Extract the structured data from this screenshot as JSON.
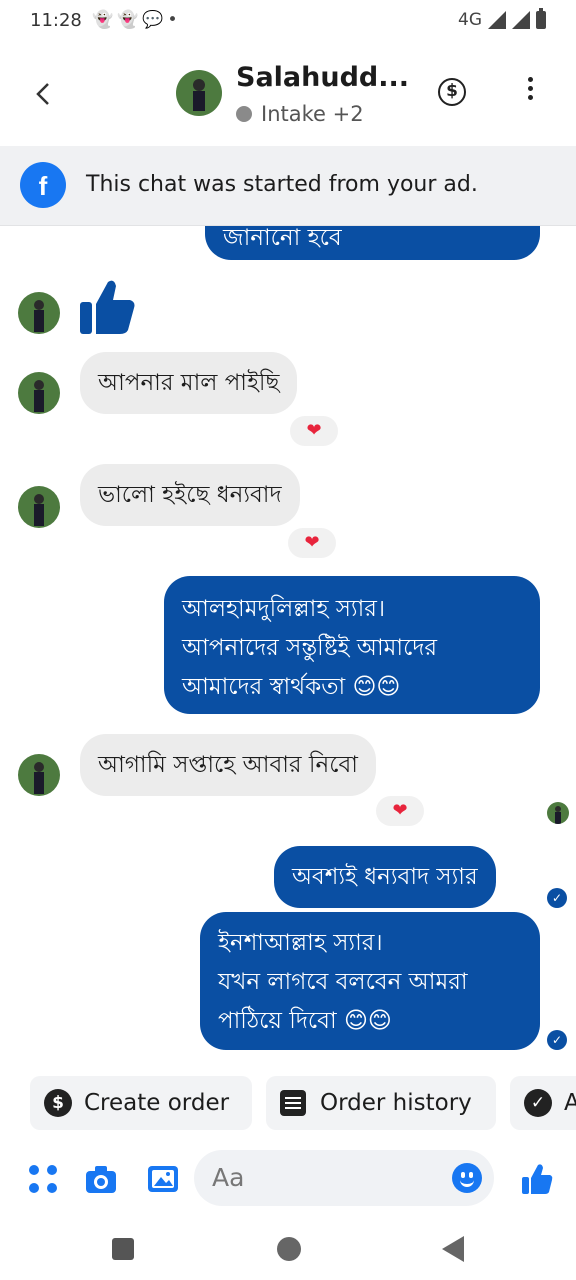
{
  "status_bar": {
    "time": "11:28",
    "network": "4G"
  },
  "header": {
    "contact_name": "Salahudd...",
    "subtitle": "Intake +2"
  },
  "ad_banner": {
    "text": "This chat was started from your ad."
  },
  "messages": {
    "partial_out_text": "জানানো হবে",
    "in_1": "আপনার মাল পাইছি",
    "in_2": "ভালো হইছে ধন্যবাদ",
    "out_1_line1": "আলহামদুলিল্লাহ স্যার।",
    "out_1_line2": "আপনাদের সন্তুষ্টিই আমাদের",
    "out_1_line3": "আমাদের স্বার্থকতা 😊😊",
    "in_3": "আগামি সপ্তাহে আবার নিবো",
    "out_2": "অবশ্যই ধন্যবাদ স্যার",
    "out_3_line1": "ইনশাআল্লাহ স্যার।",
    "out_3_line2": "যখন লাগবে বলবেন আমরা",
    "out_3_line3": "পাঠিয়ে দিবো 😊😊",
    "reaction": "❤"
  },
  "quick_replies": {
    "create_order": "Create order",
    "order_history": "Order history",
    "third_partial": "A"
  },
  "composer": {
    "placeholder": "Aa"
  },
  "colors": {
    "accent": "#1877f2",
    "outgoing_bubble": "#0a4fa3",
    "incoming_bubble": "#ececec"
  }
}
